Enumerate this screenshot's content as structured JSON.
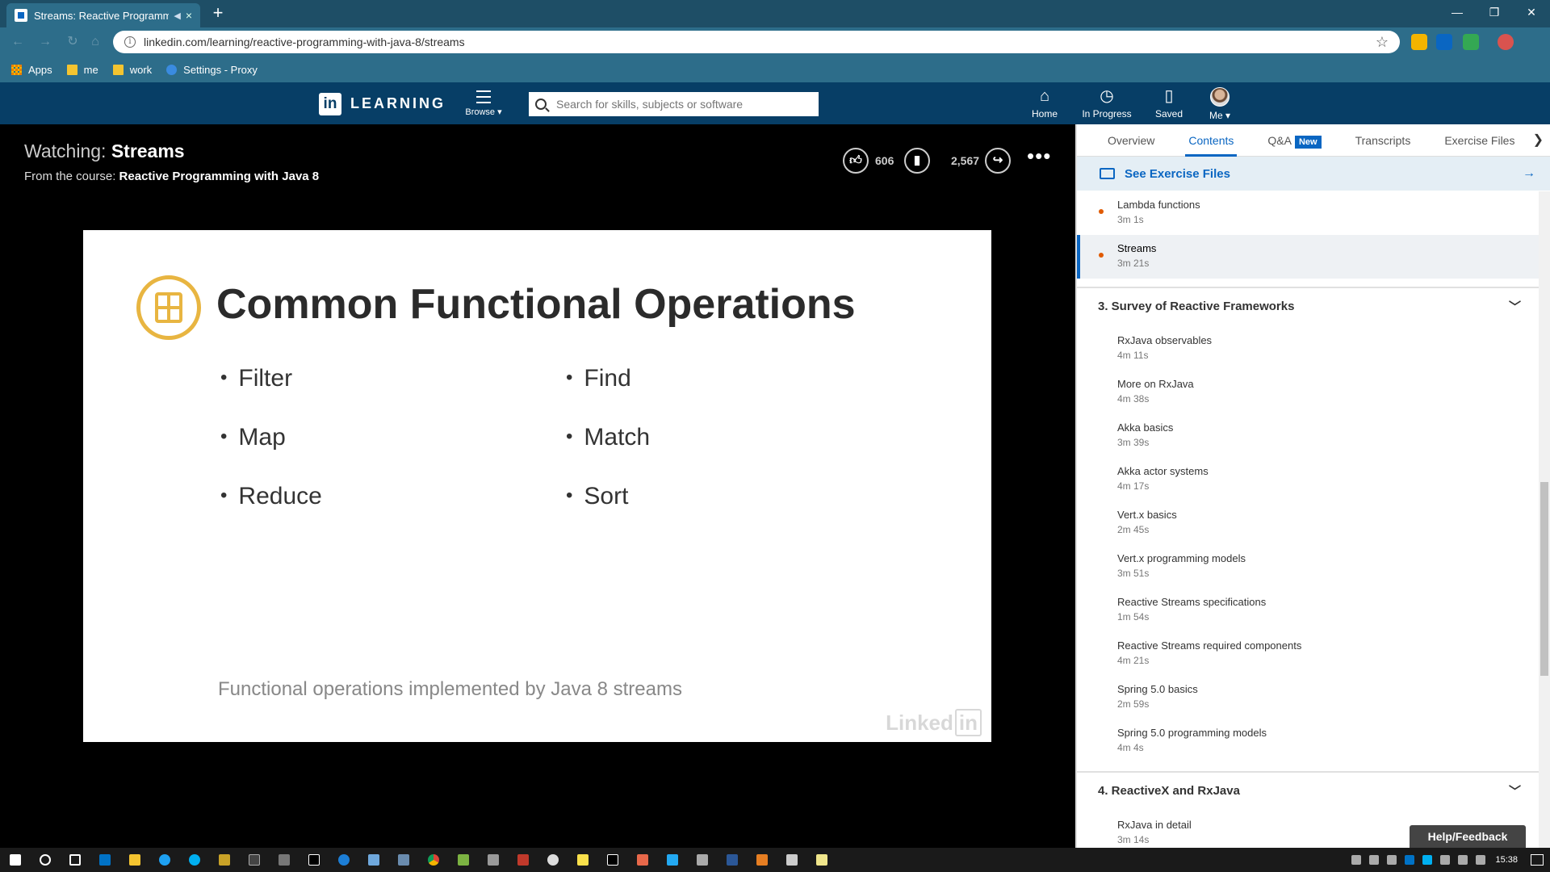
{
  "browser": {
    "tab_title": "Streams: Reactive Programm",
    "tab_close": "×",
    "new_tab": "+",
    "url": "linkedin.com/learning/reactive-programming-with-java-8/streams",
    "bookmarks": [
      "Apps",
      "me",
      "work",
      "Settings - Proxy"
    ]
  },
  "header": {
    "logo_in": "in",
    "logo_text": "LEARNING",
    "browse": "Browse ▾",
    "search_placeholder": "Search for skills, subjects or software",
    "nav": [
      "Home",
      "In Progress",
      "Saved",
      "Me ▾"
    ]
  },
  "player": {
    "watching_label": "Watching:",
    "watching_title": "Streams",
    "from_label": "From the course:",
    "course_title": "Reactive Programming with Java 8",
    "likes": "606",
    "saves": "2,567"
  },
  "slide": {
    "title": "Common Functional Operations",
    "left_bullets": [
      "Filter",
      "Map",
      "Reduce"
    ],
    "right_bullets": [
      "Find",
      "Match",
      "Sort"
    ],
    "subtitle": "Functional operations implemented by Java 8 streams",
    "watermark_a": "Linked",
    "watermark_b": "in"
  },
  "sidebar": {
    "tabs": [
      "Overview",
      "Contents",
      "Q&A",
      "Transcripts",
      "Exercise Files"
    ],
    "new_badge": "New",
    "see_exercise_files": "See Exercise Files",
    "top_items": [
      {
        "name": "Lambda functions",
        "dur": "3m 1s"
      },
      {
        "name": "Streams",
        "dur": "3m 21s"
      }
    ],
    "section3": "3. Survey of Reactive Frameworks",
    "section3_items": [
      {
        "name": "RxJava observables",
        "dur": "4m 11s"
      },
      {
        "name": "More on RxJava",
        "dur": "4m 38s"
      },
      {
        "name": "Akka basics",
        "dur": "3m 39s"
      },
      {
        "name": "Akka actor systems",
        "dur": "4m 17s"
      },
      {
        "name": "Vert.x basics",
        "dur": "2m 45s"
      },
      {
        "name": "Vert.x programming models",
        "dur": "3m 51s"
      },
      {
        "name": "Reactive Streams specifications",
        "dur": "1m 54s"
      },
      {
        "name": "Reactive Streams required components",
        "dur": "4m 21s"
      },
      {
        "name": "Spring 5.0 basics",
        "dur": "2m 59s"
      },
      {
        "name": "Spring 5.0 programming models",
        "dur": "4m 4s"
      }
    ],
    "section4": "4. ReactiveX and RxJava",
    "section4_items": [
      {
        "name": "RxJava in detail",
        "dur": "3m 14s"
      }
    ],
    "help": "Help/Feedback"
  },
  "taskbar": {
    "time": "15:38"
  }
}
